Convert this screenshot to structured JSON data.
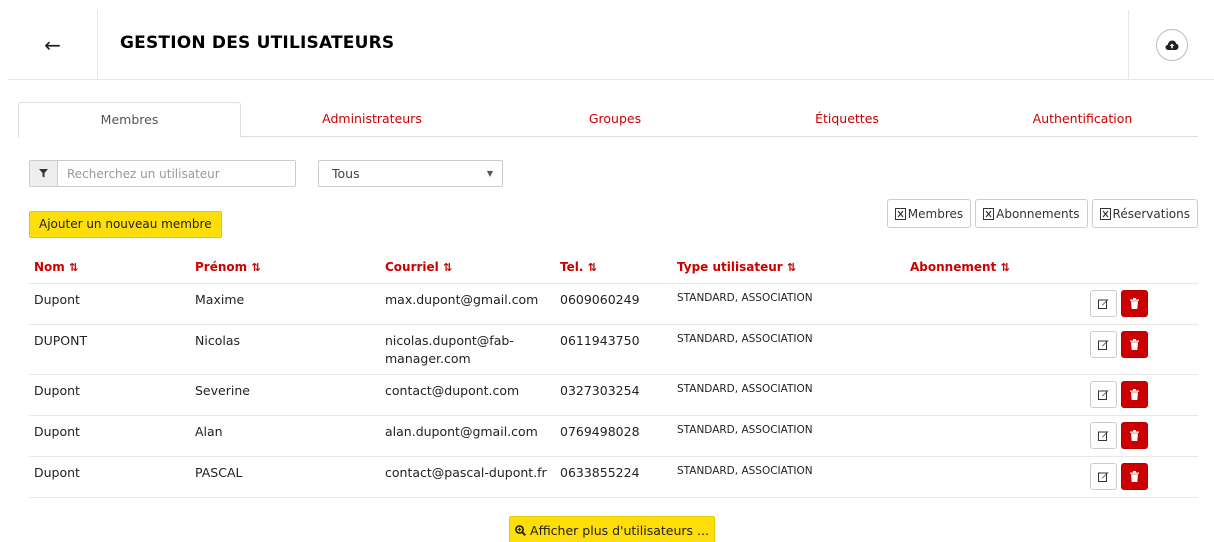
{
  "header": {
    "back_icon": "arrow-left-icon",
    "title": "GESTION DES UTILISATEURS",
    "cloud_icon": "cloud-upload-icon"
  },
  "tabs": [
    {
      "label": "Membres",
      "active": true
    },
    {
      "label": "Administrateurs",
      "active": false
    },
    {
      "label": "Groupes",
      "active": false
    },
    {
      "label": "Étiquettes",
      "active": false
    },
    {
      "label": "Authentification",
      "active": false
    }
  ],
  "search": {
    "placeholder": "Recherchez un utilisateur",
    "value": "",
    "icon": "filter-icon"
  },
  "filter_select": {
    "selected": "Tous"
  },
  "add_button": {
    "label": "Ajouter un nouveau membre"
  },
  "export_buttons": [
    {
      "label": "Membres",
      "icon": "file-excel-icon"
    },
    {
      "label": "Abonnements",
      "icon": "file-excel-icon"
    },
    {
      "label": "Réservations",
      "icon": "file-excel-icon"
    }
  ],
  "table": {
    "columns": [
      {
        "label": "Nom",
        "sort": "⇅"
      },
      {
        "label": "Prénom",
        "sort": "⇅"
      },
      {
        "label": "Courriel",
        "sort": "⇅"
      },
      {
        "label": "Tel.",
        "sort": "⇅"
      },
      {
        "label": "Type utilisateur",
        "sort": "⇅"
      },
      {
        "label": "Abonnement",
        "sort": "⇅"
      }
    ],
    "rows": [
      {
        "nom": "Dupont",
        "prenom": "Maxime",
        "courriel": "max.dupont@gmail.com",
        "tel": "0609060249",
        "type": "STANDARD, ASSOCIATION",
        "abonnement": ""
      },
      {
        "nom": "DUPONT",
        "prenom": "Nicolas",
        "courriel": "nicolas.dupont@fab-manager.com",
        "tel": "0611943750",
        "type": "STANDARD, ASSOCIATION",
        "abonnement": ""
      },
      {
        "nom": "Dupont",
        "prenom": "Severine",
        "courriel": "contact@dupont.com",
        "tel": "0327303254",
        "type": "STANDARD, ASSOCIATION",
        "abonnement": ""
      },
      {
        "nom": "Dupont",
        "prenom": "Alan",
        "courriel": "alan.dupont@gmail.com",
        "tel": "0769498028",
        "type": "STANDARD, ASSOCIATION",
        "abonnement": ""
      },
      {
        "nom": "Dupont",
        "prenom": "PASCAL",
        "courriel": "contact@pascal-dupont.fr",
        "tel": "0633855224",
        "type": "STANDARD, ASSOCIATION",
        "abonnement": ""
      }
    ]
  },
  "more_button": {
    "label": "Afficher plus d'utilisateurs ...",
    "icon": "search-plus-icon"
  },
  "colors": {
    "accent_red": "#cc0000",
    "button_yellow": "#fdde0a"
  }
}
